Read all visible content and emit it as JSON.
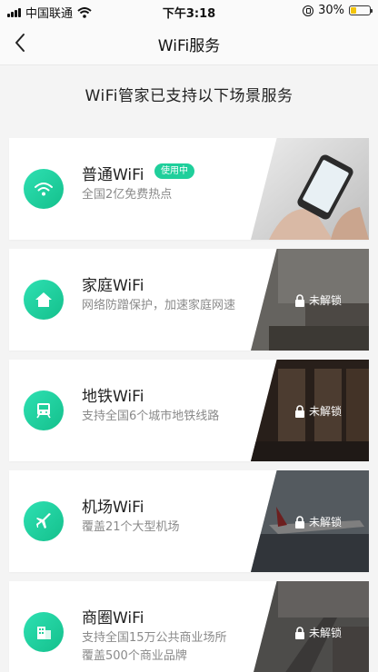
{
  "status_bar": {
    "carrier": "中国联通",
    "time": "下午3:18",
    "battery_percent": "30%",
    "battery_level": 0.3
  },
  "nav": {
    "title": "WiFi服务",
    "back_icon": "chevron-left-icon"
  },
  "headline": "WiFi管家已支持以下场景服务",
  "accent_color": "#1fcf9b",
  "cards": [
    {
      "title": "普通WiFi",
      "subtitle": "全国2亿免费热点",
      "badge": "使用中",
      "icon": "wifi-icon",
      "locked": false
    },
    {
      "title": "家庭WiFi",
      "subtitle": "网络防蹭保护，加速家庭网速",
      "icon": "home-icon",
      "locked": true,
      "lock_label": "未解锁"
    },
    {
      "title": "地铁WiFi",
      "subtitle": "支持全国6个城市地铁线路",
      "icon": "subway-icon",
      "locked": true,
      "lock_label": "未解锁"
    },
    {
      "title": "机场WiFi",
      "subtitle": "覆盖21个大型机场",
      "icon": "airplane-icon",
      "locked": true,
      "lock_label": "未解锁"
    },
    {
      "title": "商圈WiFi",
      "subtitle": "支持全国15万公共商业场所",
      "subtitle2": "覆盖500个商业品牌",
      "icon": "building-icon",
      "locked": true,
      "lock_label": "未解锁"
    }
  ]
}
